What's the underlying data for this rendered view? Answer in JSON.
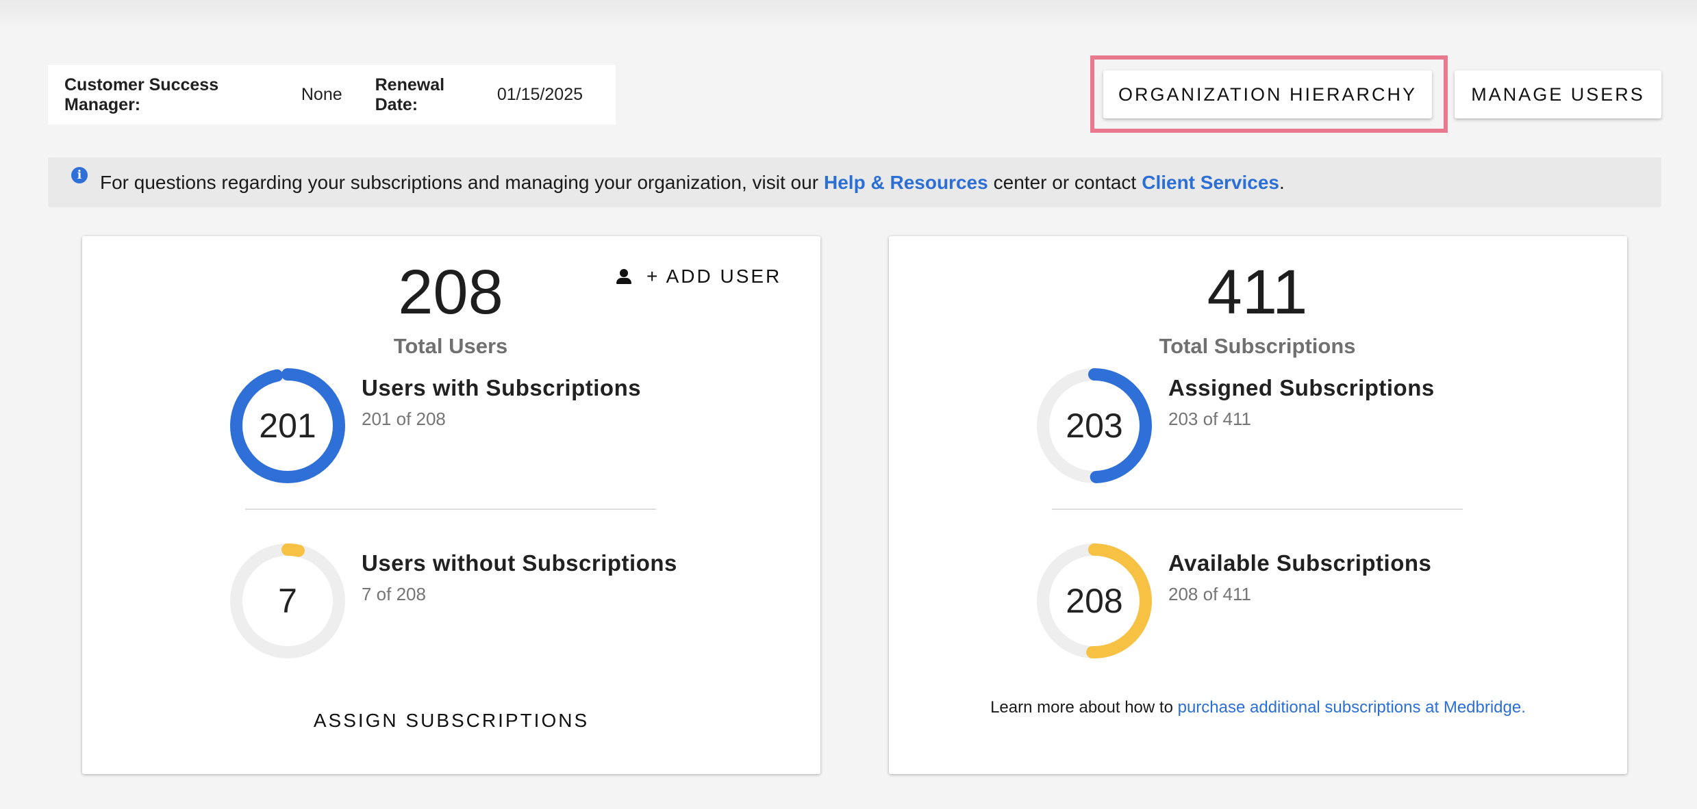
{
  "header": {
    "csm_label": "Customer Success Manager:",
    "csm_value": "None",
    "renewal_label": "Renewal Date:",
    "renewal_value": "01/15/2025"
  },
  "buttons": {
    "org_hierarchy": "ORGANIZATION HIERARCHY",
    "manage_users": "MANAGE USERS"
  },
  "notice": {
    "text_before": "For questions regarding your subscriptions and managing your organization, visit our",
    "help_link": "Help & Resources",
    "text_middle": "center or contact",
    "client_link": "Client Services",
    "text_after": "."
  },
  "users_card": {
    "total": "208",
    "total_label": "Total Users",
    "add_user": "+ ADD USER",
    "with_subs": {
      "count": "201",
      "title": "Users with Subscriptions",
      "sub": "201 of 208",
      "fraction": 0.966
    },
    "without_subs": {
      "count": "7",
      "title": "Users without Subscriptions",
      "sub": "7 of 208",
      "fraction": 0.034
    },
    "assign": "ASSIGN SUBSCRIPTIONS"
  },
  "subs_card": {
    "total": "411",
    "total_label": "Total Subscriptions",
    "assigned": {
      "count": "203",
      "title": "Assigned Subscriptions",
      "sub": "203 of 411",
      "fraction": 0.494
    },
    "available": {
      "count": "208",
      "title": "Available Subscriptions",
      "sub": "208 of 411",
      "fraction": 0.506
    },
    "learn_text": "Learn more about how to",
    "learn_link": "purchase additional subscriptions at Medbridge."
  },
  "colors": {
    "blue": "#2e6fd8",
    "yellow": "#f7c244",
    "track": "#eeeeee",
    "highlight": "#e8798e"
  }
}
